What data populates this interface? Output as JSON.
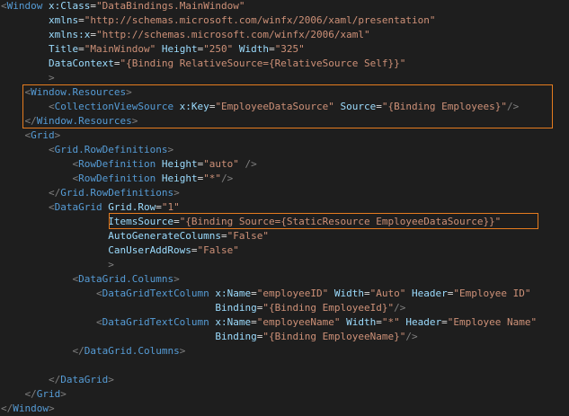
{
  "colors": {
    "background": "#1e1e1e",
    "bracket": "#808080",
    "tag": "#569cd6",
    "attr": "#9cdcfe",
    "string": "#ce9178",
    "text": "#dcdcdc",
    "highlight_border": "#e57c1f"
  },
  "lines": [
    [
      {
        "t": "<",
        "c": "b"
      },
      {
        "t": "Window",
        "c": "tag"
      },
      {
        "t": " x:Class",
        "c": "attr"
      },
      {
        "t": "=",
        "c": "text"
      },
      {
        "t": "\"DataBindings.MainWindow\"",
        "c": "str"
      }
    ],
    [
      {
        "t": "        xmlns",
        "c": "attr"
      },
      {
        "t": "=",
        "c": "text"
      },
      {
        "t": "\"http://schemas.microsoft.com/winfx/2006/xaml/presentation\"",
        "c": "str"
      }
    ],
    [
      {
        "t": "        xmlns:x",
        "c": "attr"
      },
      {
        "t": "=",
        "c": "text"
      },
      {
        "t": "\"http://schemas.microsoft.com/winfx/2006/xaml\"",
        "c": "str"
      }
    ],
    [
      {
        "t": "        Title",
        "c": "attr"
      },
      {
        "t": "=",
        "c": "text"
      },
      {
        "t": "\"MainWindow\"",
        "c": "str"
      },
      {
        "t": " Height",
        "c": "attr"
      },
      {
        "t": "=",
        "c": "text"
      },
      {
        "t": "\"250\"",
        "c": "str"
      },
      {
        "t": " Width",
        "c": "attr"
      },
      {
        "t": "=",
        "c": "text"
      },
      {
        "t": "\"325\"",
        "c": "str"
      }
    ],
    [
      {
        "t": "        DataContext",
        "c": "attr"
      },
      {
        "t": "=",
        "c": "text"
      },
      {
        "t": "\"{Binding RelativeSource={RelativeSource Self}}\"",
        "c": "str"
      }
    ],
    [
      {
        "t": "        ",
        "c": "text"
      },
      {
        "t": ">",
        "c": "b"
      }
    ],
    [
      {
        "t": "    ",
        "c": "text"
      },
      {
        "t": "<",
        "c": "b"
      },
      {
        "t": "Window.Resources",
        "c": "tag"
      },
      {
        "t": ">",
        "c": "b"
      }
    ],
    [
      {
        "t": "        ",
        "c": "text"
      },
      {
        "t": "<",
        "c": "b"
      },
      {
        "t": "CollectionViewSource",
        "c": "tag"
      },
      {
        "t": " x:Key",
        "c": "attr"
      },
      {
        "t": "=",
        "c": "text"
      },
      {
        "t": "\"EmployeeDataSource\"",
        "c": "str"
      },
      {
        "t": " Source",
        "c": "attr"
      },
      {
        "t": "=",
        "c": "text"
      },
      {
        "t": "\"{Binding Employees}\"",
        "c": "str"
      },
      {
        "t": "/>",
        "c": "b"
      }
    ],
    [
      {
        "t": "    ",
        "c": "text"
      },
      {
        "t": "</",
        "c": "b"
      },
      {
        "t": "Window.Resources",
        "c": "tag"
      },
      {
        "t": ">",
        "c": "b"
      }
    ],
    [
      {
        "t": "    ",
        "c": "text"
      },
      {
        "t": "<",
        "c": "b"
      },
      {
        "t": "Grid",
        "c": "tag"
      },
      {
        "t": ">",
        "c": "b"
      }
    ],
    [
      {
        "t": "        ",
        "c": "text"
      },
      {
        "t": "<",
        "c": "b"
      },
      {
        "t": "Grid.RowDefinitions",
        "c": "tag"
      },
      {
        "t": ">",
        "c": "b"
      }
    ],
    [
      {
        "t": "            ",
        "c": "text"
      },
      {
        "t": "<",
        "c": "b"
      },
      {
        "t": "RowDefinition",
        "c": "tag"
      },
      {
        "t": " Height",
        "c": "attr"
      },
      {
        "t": "=",
        "c": "text"
      },
      {
        "t": "\"auto\"",
        "c": "str"
      },
      {
        "t": " />",
        "c": "b"
      }
    ],
    [
      {
        "t": "            ",
        "c": "text"
      },
      {
        "t": "<",
        "c": "b"
      },
      {
        "t": "RowDefinition",
        "c": "tag"
      },
      {
        "t": " Height",
        "c": "attr"
      },
      {
        "t": "=",
        "c": "text"
      },
      {
        "t": "\"*\"",
        "c": "str"
      },
      {
        "t": "/>",
        "c": "b"
      }
    ],
    [
      {
        "t": "        ",
        "c": "text"
      },
      {
        "t": "</",
        "c": "b"
      },
      {
        "t": "Grid.RowDefinitions",
        "c": "tag"
      },
      {
        "t": ">",
        "c": "b"
      }
    ],
    [
      {
        "t": "        ",
        "c": "text"
      },
      {
        "t": "<",
        "c": "b"
      },
      {
        "t": "DataGrid",
        "c": "tag"
      },
      {
        "t": " Grid.Row",
        "c": "attr"
      },
      {
        "t": "=",
        "c": "text"
      },
      {
        "t": "\"1\"",
        "c": "str"
      }
    ],
    [
      {
        "t": "                  ItemsSource",
        "c": "attr"
      },
      {
        "t": "=",
        "c": "text"
      },
      {
        "t": "\"{Binding Source={StaticResource EmployeeDataSource}}\"",
        "c": "str"
      }
    ],
    [
      {
        "t": "                  AutoGenerateColumns",
        "c": "attr"
      },
      {
        "t": "=",
        "c": "text"
      },
      {
        "t": "\"False\"",
        "c": "str"
      }
    ],
    [
      {
        "t": "                  CanUserAddRows",
        "c": "attr"
      },
      {
        "t": "=",
        "c": "text"
      },
      {
        "t": "\"False\"",
        "c": "str"
      }
    ],
    [
      {
        "t": "                  ",
        "c": "text"
      },
      {
        "t": ">",
        "c": "b"
      }
    ],
    [
      {
        "t": "            ",
        "c": "text"
      },
      {
        "t": "<",
        "c": "b"
      },
      {
        "t": "DataGrid.Columns",
        "c": "tag"
      },
      {
        "t": ">",
        "c": "b"
      }
    ],
    [
      {
        "t": "                ",
        "c": "text"
      },
      {
        "t": "<",
        "c": "b"
      },
      {
        "t": "DataGridTextColumn",
        "c": "tag"
      },
      {
        "t": " x:Name",
        "c": "attr"
      },
      {
        "t": "=",
        "c": "text"
      },
      {
        "t": "\"employeeID\"",
        "c": "str"
      },
      {
        "t": " Width",
        "c": "attr"
      },
      {
        "t": "=",
        "c": "text"
      },
      {
        "t": "\"Auto\"",
        "c": "str"
      },
      {
        "t": " Header",
        "c": "attr"
      },
      {
        "t": "=",
        "c": "text"
      },
      {
        "t": "\"Employee ID\"",
        "c": "str"
      }
    ],
    [
      {
        "t": "                                    Binding",
        "c": "attr"
      },
      {
        "t": "=",
        "c": "text"
      },
      {
        "t": "\"{Binding EmployeeId}\"",
        "c": "str"
      },
      {
        "t": "/>",
        "c": "b"
      }
    ],
    [
      {
        "t": "                ",
        "c": "text"
      },
      {
        "t": "<",
        "c": "b"
      },
      {
        "t": "DataGridTextColumn",
        "c": "tag"
      },
      {
        "t": " x:Name",
        "c": "attr"
      },
      {
        "t": "=",
        "c": "text"
      },
      {
        "t": "\"employeeName\"",
        "c": "str"
      },
      {
        "t": " Width",
        "c": "attr"
      },
      {
        "t": "=",
        "c": "text"
      },
      {
        "t": "\"*\"",
        "c": "str"
      },
      {
        "t": " Header",
        "c": "attr"
      },
      {
        "t": "=",
        "c": "text"
      },
      {
        "t": "\"Employee Name\"",
        "c": "str"
      }
    ],
    [
      {
        "t": "                                    Binding",
        "c": "attr"
      },
      {
        "t": "=",
        "c": "text"
      },
      {
        "t": "\"{Binding EmployeeName}\"",
        "c": "str"
      },
      {
        "t": "/>",
        "c": "b"
      }
    ],
    [
      {
        "t": "            ",
        "c": "text"
      },
      {
        "t": "</",
        "c": "b"
      },
      {
        "t": "DataGrid.Columns",
        "c": "tag"
      },
      {
        "t": ">",
        "c": "b"
      }
    ],
    [],
    [
      {
        "t": "        ",
        "c": "text"
      },
      {
        "t": "</",
        "c": "b"
      },
      {
        "t": "DataGrid",
        "c": "tag"
      },
      {
        "t": ">",
        "c": "b"
      }
    ],
    [
      {
        "t": "    ",
        "c": "text"
      },
      {
        "t": "</",
        "c": "b"
      },
      {
        "t": "Grid",
        "c": "tag"
      },
      {
        "t": ">",
        "c": "b"
      }
    ],
    [
      {
        "t": "</",
        "c": "b"
      },
      {
        "t": "Window",
        "c": "tag"
      },
      {
        "t": ">",
        "c": "b"
      }
    ]
  ]
}
